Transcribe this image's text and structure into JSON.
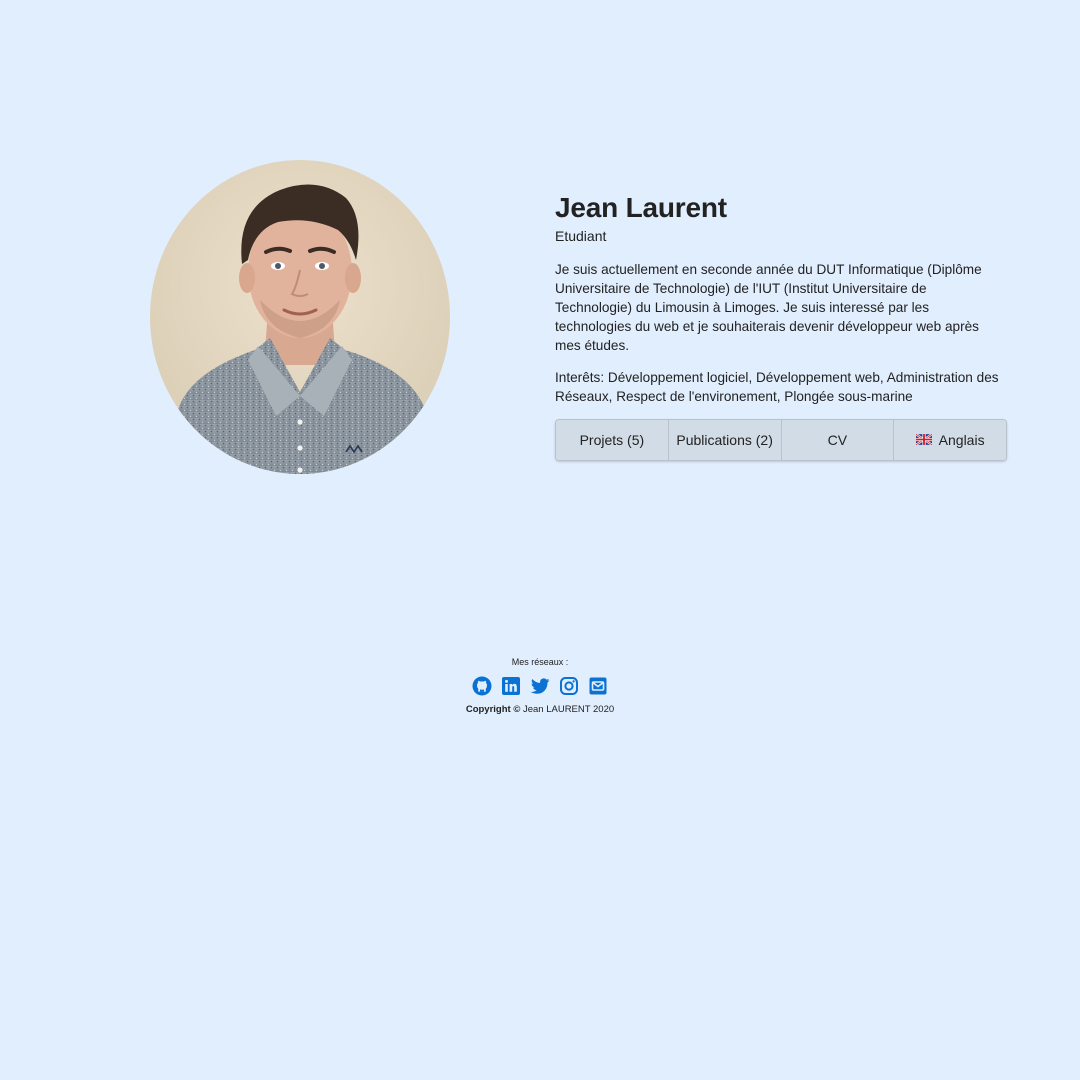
{
  "profile": {
    "name": "Jean Laurent",
    "role": "Etudiant",
    "bio": "Je suis actuellement en seconde année du DUT Informatique (Diplôme Universitaire de Technologie) de l'IUT (Institut Universitaire de Technologie) du Limousin à Limoges. Je suis interessé par les technologies du web et je souhaiterais devenir développeur web après mes études.",
    "interests": "Interêts: Développement logiciel, Développement web, Administration des Réseaux, Respect de l'environement, Plongée sous-marine"
  },
  "nav": {
    "projects_label": "Projets (5)",
    "publications_label": "Publications (2)",
    "cv_label": "CV",
    "language_label": "Anglais",
    "language_icon": "uk-flag-icon"
  },
  "footer": {
    "networks_label": "Mes réseaux :",
    "social_icons": [
      "github-icon",
      "linkedin-icon",
      "twitter-icon",
      "instagram-icon",
      "email-icon"
    ],
    "copyright_prefix": "Copyright ©",
    "copyright_owner": "Jean LAURENT 2020"
  },
  "colors": {
    "background": "#e1eefe",
    "button_bg": "#d2dce6",
    "social_blue": "#0b72d4"
  }
}
